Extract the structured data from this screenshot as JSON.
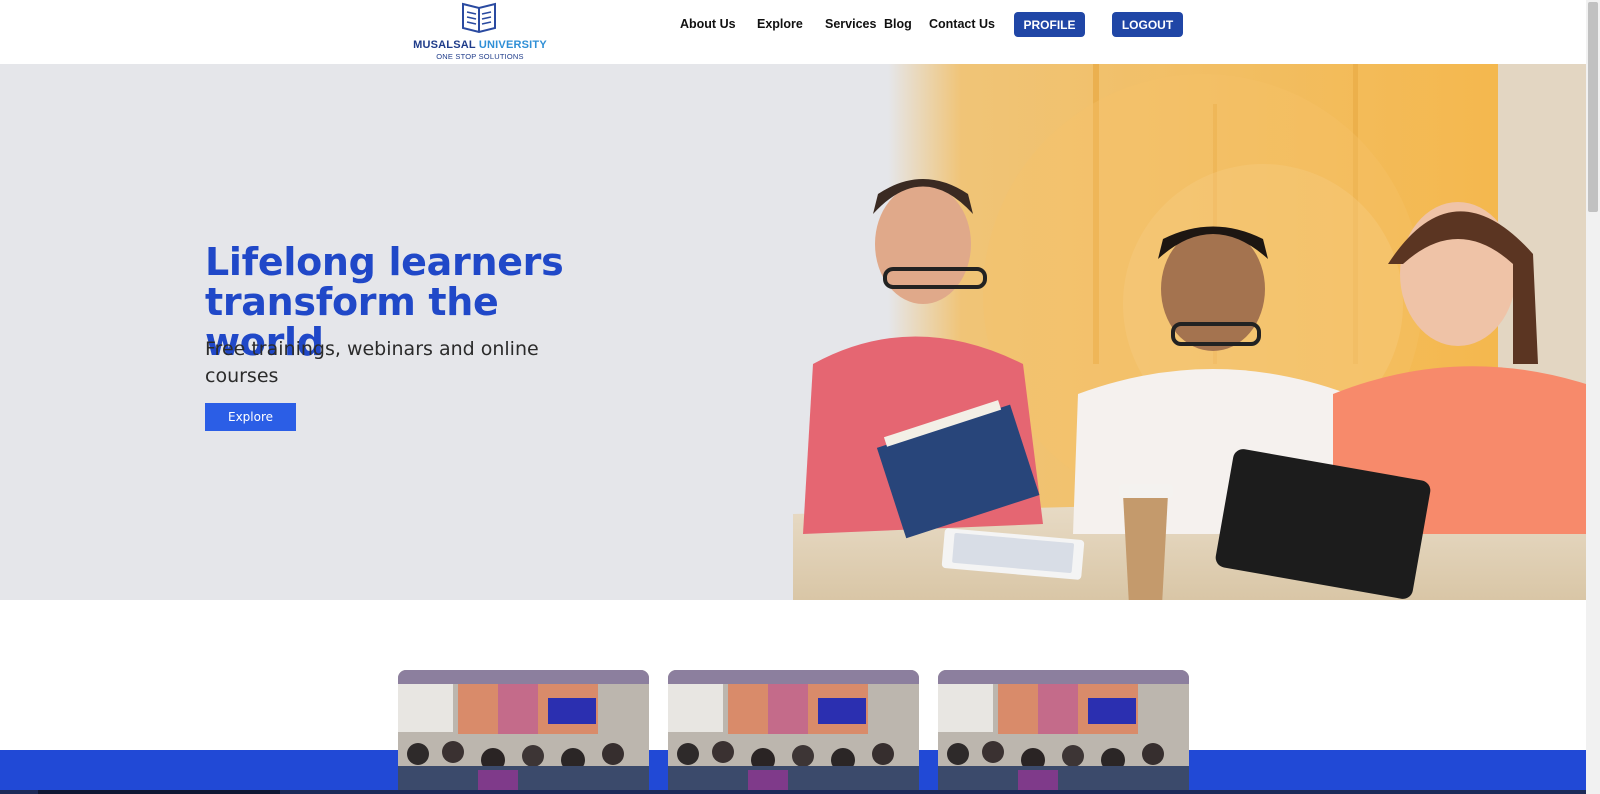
{
  "brand": {
    "name_main": "MUSALSAL ",
    "name_accent": "UNIVERSITY",
    "tagline": "ONE STOP SOLUTIONS",
    "colors": {
      "primary": "#2046a6",
      "accent": "#2f8fd6"
    }
  },
  "nav": {
    "items": [
      {
        "label": "About Us"
      },
      {
        "label": "Explore"
      },
      {
        "label": "Services"
      },
      {
        "label": "Blog"
      },
      {
        "label": "Contact Us"
      }
    ],
    "profile_label": "PROFILE",
    "logout_label": "LOGOUT"
  },
  "hero": {
    "title_line1": "Lifelong learners",
    "title_line2": "transform the world",
    "subtitle": "Free trainings, webinars and online courses",
    "cta_label": "Explore",
    "colors": {
      "title": "#2048c8",
      "cta": "#2b5ee6",
      "background": "#e5e6ea"
    }
  },
  "cards": [
    {
      "icon": "classroom-photo"
    },
    {
      "icon": "classroom-photo"
    },
    {
      "icon": "classroom-photo"
    }
  ],
  "footer_band_color": "#2149d6"
}
